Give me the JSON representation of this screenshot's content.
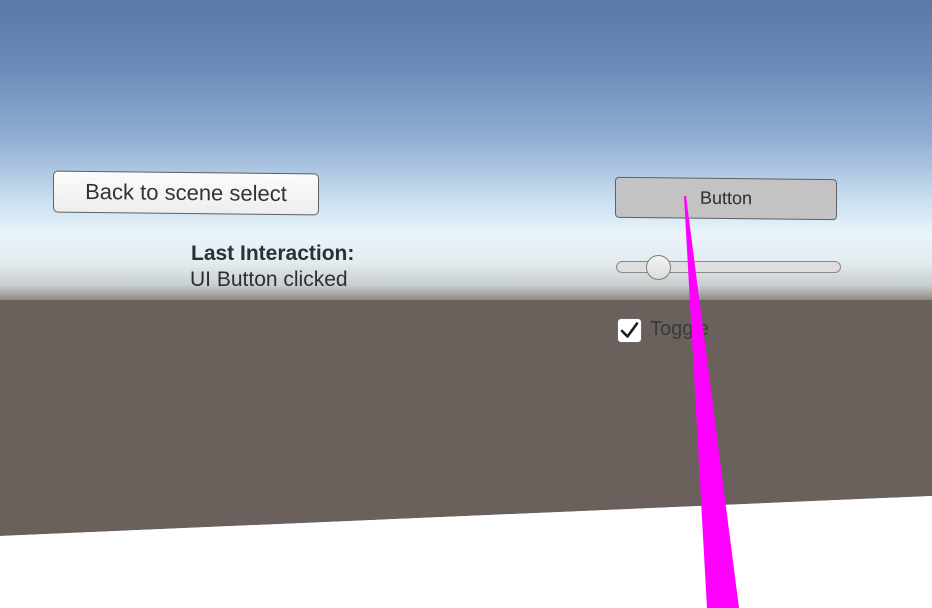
{
  "scene": {
    "sky_color": "#6d8cb9",
    "horizon_color": "#e9f4fa",
    "ground_color": "#6a615c",
    "floor_color": "#ffffff",
    "pointer_color": "#ff00ff"
  },
  "panel": {
    "back_button_label": "Back to scene select",
    "last_interaction_title": "Last Interaction:",
    "last_interaction_value": "UI Button clicked",
    "button_label": "Button",
    "slider_value": 0.15,
    "toggle_checked": true,
    "toggle_label": "Toggle"
  }
}
